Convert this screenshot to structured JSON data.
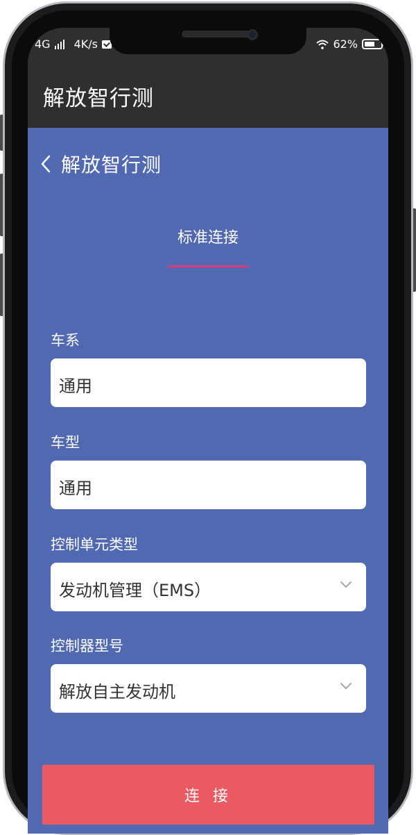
{
  "status_bar": {
    "network": "4G",
    "speed": "4K/s",
    "battery": "62%",
    "battery_level": 0.62
  },
  "app_bar": {
    "title": "解放智行测"
  },
  "page": {
    "back_label": "解放智行测",
    "tab_label": "标准连接"
  },
  "form": {
    "series": {
      "label": "车系",
      "value": "通用"
    },
    "model": {
      "label": "车型",
      "value": "通用"
    },
    "unit_type": {
      "label": "控制单元类型",
      "value": "发动机管理（EMS）"
    },
    "controller_model": {
      "label": "控制器型号",
      "value": "解放自主发动机"
    }
  },
  "connect_button": {
    "label": "连 接"
  },
  "colors": {
    "content_bg": "#5169b1",
    "app_bar_bg": "#2f2f30",
    "tab_underline": "#e0397a",
    "connect_button_bg": "#e95a62"
  }
}
